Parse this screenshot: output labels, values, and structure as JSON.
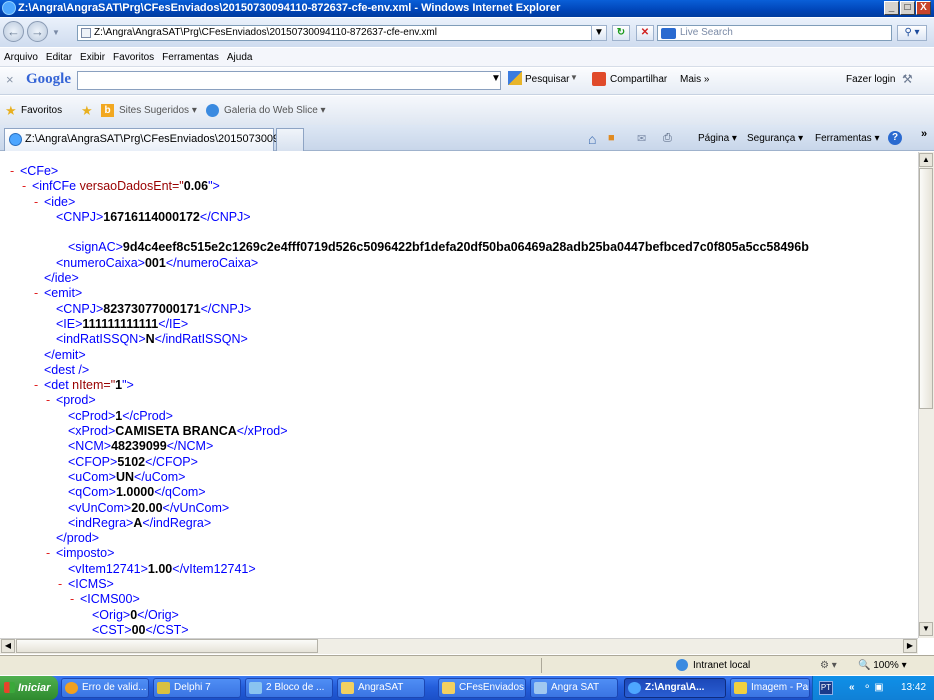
{
  "window": {
    "title": "Z:\\Angra\\AngraSAT\\Prg\\CFesEnviados\\20150730094110-872637-cfe-env.xml - Windows Internet Explorer",
    "minimize": "_",
    "maximize": "□",
    "close": "X"
  },
  "address": {
    "url": "Z:\\Angra\\AngraSAT\\Prg\\CFesEnviados\\20150730094110-872637-cfe-env.xml",
    "search_placeholder": "Live Search"
  },
  "menu": [
    "Arquivo",
    "Editar",
    "Exibir",
    "Favoritos",
    "Ferramentas",
    "Ajuda"
  ],
  "google_toolbar": {
    "close": "×",
    "logo": "Google",
    "pesquisar": "Pesquisar",
    "compartilhar": "Compartilhar",
    "mais": "Mais »",
    "login": "Fazer login"
  },
  "favorites": {
    "favoritos": "Favoritos",
    "sites": "Sites Sugeridos ▾",
    "galeria": "Galeria do Web Slice ▾"
  },
  "tab": {
    "label": "Z:\\Angra\\AngraSAT\\Prg\\CFesEnviados\\20150730094...",
    "pagina": "Página ▾",
    "seguranca": "Segurança ▾",
    "ferramentas": "Ferramentas ▾"
  },
  "xml_lines": [
    {
      "indent": 0,
      "marker": "-",
      "open": "<CFe>"
    },
    {
      "indent": 1,
      "marker": "-",
      "open": "<infCFe ",
      "attr": "versaoDadosEnt=\"",
      "attrval": "0.06",
      "attrend": "\">"
    },
    {
      "indent": 2,
      "marker": "-",
      "open": "<ide>"
    },
    {
      "indent": 3,
      "marker": "",
      "open": "<CNPJ>",
      "value": "16716114000172",
      "close": "</CNPJ>"
    },
    {
      "indent": 3,
      "marker": "",
      "open": ""
    },
    {
      "indent": 4,
      "marker": "",
      "open": "<signAC>",
      "value": "9d4c4eef8c515e2c1269c2e4fff0719d526c5096422bf1defa20df50ba06469a28adb25ba0447befbced7c0f805a5cc58496b",
      "close": ""
    },
    {
      "indent": 3,
      "marker": "",
      "open": "<numeroCaixa>",
      "value": "001",
      "close": "</numeroCaixa>"
    },
    {
      "indent": 2,
      "marker": "",
      "open": "</ide>"
    },
    {
      "indent": 2,
      "marker": "-",
      "open": "<emit>"
    },
    {
      "indent": 3,
      "marker": "",
      "open": "<CNPJ>",
      "value": "82373077000171",
      "close": "</CNPJ>"
    },
    {
      "indent": 3,
      "marker": "",
      "open": "<IE>",
      "value": "111111111111",
      "close": "</IE>"
    },
    {
      "indent": 3,
      "marker": "",
      "open": "<indRatISSQN>",
      "value": "N",
      "close": "</indRatISSQN>"
    },
    {
      "indent": 2,
      "marker": "",
      "open": "</emit>"
    },
    {
      "indent": 2,
      "marker": "",
      "open": "<dest />"
    },
    {
      "indent": 2,
      "marker": "-",
      "open": "<det ",
      "attr": "nItem=\"",
      "attrval": "1",
      "attrend": "\">"
    },
    {
      "indent": 3,
      "marker": "-",
      "open": "<prod>"
    },
    {
      "indent": 4,
      "marker": "",
      "open": "<cProd>",
      "value": "1",
      "close": "</cProd>"
    },
    {
      "indent": 4,
      "marker": "",
      "open": "<xProd>",
      "value": "CAMISETA BRANCA",
      "close": "</xProd>"
    },
    {
      "indent": 4,
      "marker": "",
      "open": "<NCM>",
      "value": "48239099",
      "close": "</NCM>"
    },
    {
      "indent": 4,
      "marker": "",
      "open": "<CFOP>",
      "value": "5102",
      "close": "</CFOP>"
    },
    {
      "indent": 4,
      "marker": "",
      "open": "<uCom>",
      "value": "UN",
      "close": "</uCom>"
    },
    {
      "indent": 4,
      "marker": "",
      "open": "<qCom>",
      "value": "1.0000",
      "close": "</qCom>"
    },
    {
      "indent": 4,
      "marker": "",
      "open": "<vUnCom>",
      "value": "20.00",
      "close": "</vUnCom>"
    },
    {
      "indent": 4,
      "marker": "",
      "open": "<indRegra>",
      "value": "A",
      "close": "</indRegra>"
    },
    {
      "indent": 3,
      "marker": "",
      "open": "</prod>"
    },
    {
      "indent": 3,
      "marker": "-",
      "open": "<imposto>"
    },
    {
      "indent": 4,
      "marker": "",
      "open": "<vItem12741>",
      "value": "1.00",
      "close": "</vItem12741>"
    },
    {
      "indent": 4,
      "marker": "-",
      "open": "<ICMS>"
    },
    {
      "indent": 5,
      "marker": "-",
      "open": "<ICMS00>"
    },
    {
      "indent": 6,
      "marker": "",
      "open": "<Orig>",
      "value": "0",
      "close": "</Orig>"
    },
    {
      "indent": 6,
      "marker": "",
      "open": "<CST>",
      "value": "00",
      "close": "</CST>"
    }
  ],
  "status": {
    "zone": "Intranet local",
    "zoom": "100%"
  },
  "taskbar": {
    "start": "Iniciar",
    "items": [
      "Erro de valid...",
      "Delphi 7",
      "2 Bloco de ...",
      "AngraSAT",
      "CFesEnviados",
      "Angra SAT",
      "Z:\\Angra\\A...",
      "Imagem - Paint"
    ],
    "lang": "PT",
    "clock": "13:42"
  }
}
